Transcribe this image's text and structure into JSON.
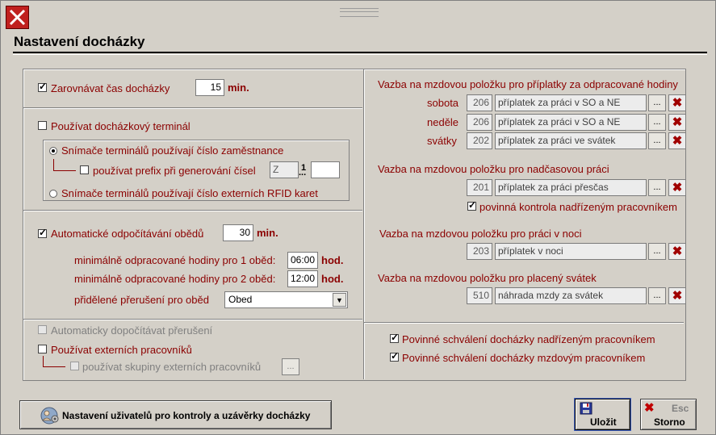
{
  "window": {
    "title": "Nastavení docházky"
  },
  "left": {
    "align": {
      "label": "Zarovnávat čas docházky",
      "checked": true,
      "value": "15",
      "unit": "min."
    },
    "terminal": {
      "label": "Používat docházkový terminál",
      "checked": false,
      "radio1": "Snímače terminálů používají číslo zaměstnance",
      "prefix_label": "používat prefix při generování čísel",
      "prefix_value": "Z",
      "prefix_sep": "1",
      "prefix_dots": "...",
      "prefix_value2": "",
      "radio2": "Snímače terminálů používají číslo externích RFID karet"
    },
    "lunch": {
      "label": "Automatické odpočítávání obědů",
      "checked": true,
      "value": "30",
      "unit": "min.",
      "min1_label": "minimálně odpracované hodiny pro 1 oběd:",
      "min1_value": "06:00",
      "min2_label": "minimálně odpracované hodiny pro 2 oběd:",
      "min2_value": "12:00",
      "hours_unit": "hod.",
      "break_label": "přidělené přerušení pro oběd",
      "break_value": "Obed"
    },
    "auto_break": {
      "label": "Automaticky dopočítávat přerušení",
      "checked": false
    },
    "external": {
      "label": "Používat externích pracovníků",
      "checked": false,
      "groups_label": "používat skupiny externích pracovníků",
      "dots": "..."
    }
  },
  "right": {
    "overtime_section": {
      "title": "Vazba na mzdovou položku pro příplatky za odpracované hodiny",
      "rows": [
        {
          "label": "sobota",
          "code": "206",
          "name": "příplatek za práci v SO a NE"
        },
        {
          "label": "neděle",
          "code": "206",
          "name": "příplatek za práci v SO a NE"
        },
        {
          "label": "svátky",
          "code": "202",
          "name": "příplatek za práci ve svátek"
        }
      ]
    },
    "extra_section": {
      "title": "Vazba na mzdovou položku pro nadčasovou práci",
      "code": "201",
      "name": "příplatek za práci přesčas",
      "check_label": "povinná kontrola nadřízeným pracovníkem",
      "checked": true
    },
    "night_section": {
      "title": "Vazba na mzdovou položku pro práci v noci",
      "code": "203",
      "name": "příplatek v noci"
    },
    "holiday_section": {
      "title": "Vazba na mzdovou položku pro placený svátek",
      "code": "510",
      "name": "náhrada mzdy za svátek"
    },
    "approve1": {
      "label": "Povinné schválení docházky nadřízeným pracovníkem",
      "checked": true
    },
    "approve2": {
      "label": "Povinné schválení docházky mzdovým pracovníkem",
      "checked": true
    },
    "dots": "...",
    "clear": "✖"
  },
  "footer": {
    "users_button": "Nastavení uživatelů pro kontroly a uzávěrky docházky",
    "save_label": "Uložit",
    "cancel_label": "Storno",
    "cancel_key": "Esc"
  },
  "colors": {
    "accent_red": "#8b0000",
    "close_bg": "#c0201e"
  }
}
